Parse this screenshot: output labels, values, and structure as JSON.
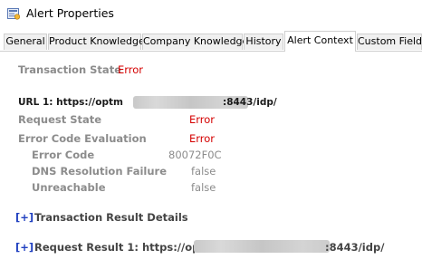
{
  "window": {
    "title": "Alert Properties",
    "icon": "alert-properties-icon"
  },
  "tabs": [
    {
      "label": "General"
    },
    {
      "label": "Product Knowledge"
    },
    {
      "label": "Company Knowledge"
    },
    {
      "label": "History"
    },
    {
      "label": "Alert Context",
      "active": true
    },
    {
      "label": "Custom Fields"
    }
  ],
  "context": {
    "transaction_state_label": "Transaction State",
    "transaction_state_value": "Error",
    "url1_prefix": "URL 1: https://optm",
    "url1_suffix": ":8443/idp/",
    "request_state_label": "Request State",
    "request_state_value": "Error",
    "error_code_eval_label": "Error Code Evaluation",
    "error_code_eval_value": "Error",
    "error_code_label": "Error Code",
    "error_code_value": "80072F0C",
    "dns_label": "DNS Resolution Failure",
    "dns_value": "false",
    "unreachable_label": "Unreachable",
    "unreachable_value": "false",
    "expander_symbol": "[+]",
    "transaction_result_label": "Transaction Result Details",
    "request_result_prefix": "Request Result 1: https://optm",
    "request_result_suffix": ":8443/idp/"
  },
  "colors": {
    "error": "#d40000",
    "label_gray": "#8c8c8c",
    "expander_blue": "#1f3fc0"
  }
}
